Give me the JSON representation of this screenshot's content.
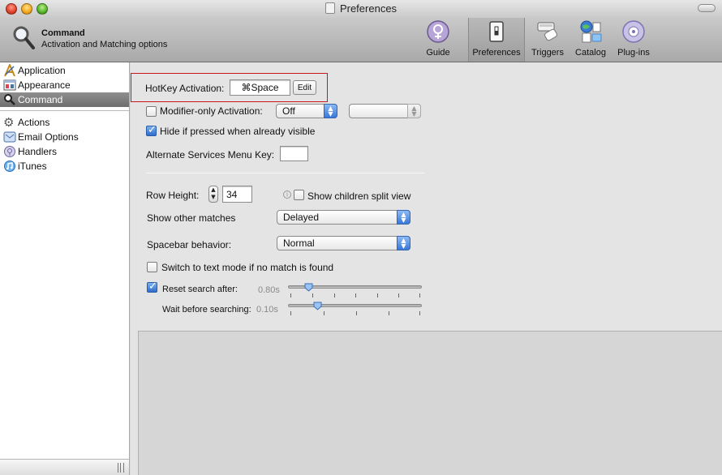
{
  "window": {
    "title": "Preferences"
  },
  "header": {
    "title": "Command",
    "subtitle": "Activation and Matching options"
  },
  "toolbar": {
    "items": [
      {
        "label": "Guide",
        "icon": "guide-icon"
      },
      {
        "label": "Preferences",
        "icon": "preferences-switch-icon",
        "selected": true
      },
      {
        "label": "Triggers",
        "icon": "triggers-icon"
      },
      {
        "label": "Catalog",
        "icon": "catalog-icon"
      },
      {
        "label": "Plug-ins",
        "icon": "plugins-icon"
      }
    ]
  },
  "sidebar": {
    "items": [
      {
        "label": "Application",
        "icon": "application-icon"
      },
      {
        "label": "Appearance",
        "icon": "appearance-icon"
      },
      {
        "label": "Command",
        "icon": "magnifier-icon",
        "selected": true
      },
      {
        "label": "Actions",
        "icon": "gear-icon"
      },
      {
        "label": "Email Options",
        "icon": "email-icon"
      },
      {
        "label": "Handlers",
        "icon": "handlers-icon"
      },
      {
        "label": "iTunes",
        "icon": "itunes-icon"
      }
    ]
  },
  "settings": {
    "hotkey": {
      "label": "HotKey Activation:",
      "value": "⌘Space",
      "edit_label": "Edit"
    },
    "modifier_only": {
      "label": "Modifier-only Activation:",
      "checked": false,
      "value": "Off"
    },
    "hide_if_visible": {
      "label": "Hide if pressed when already visible",
      "checked": true
    },
    "alt_services": {
      "label": "Alternate Services Menu Key:",
      "value": ""
    },
    "row_height": {
      "label": "Row Height:",
      "value": "34"
    },
    "children_split": {
      "label": "Show children split view",
      "checked": false
    },
    "other_matches": {
      "label": "Show other matches",
      "value": "Delayed"
    },
    "spacebar": {
      "label": "Spacebar behavior:",
      "value": "Normal"
    },
    "text_mode": {
      "label": "Switch to text mode if no match is found",
      "checked": false
    },
    "reset_search": {
      "label": "Reset search after:",
      "checked": true,
      "value": "0.80s",
      "fraction": 0.15
    },
    "wait_before": {
      "label": "Wait before searching:",
      "value": "0.10s",
      "fraction": 0.22
    }
  },
  "colors": {
    "highlight_box": "#c8161d",
    "checkbox_accent": "#2f6dcc"
  }
}
